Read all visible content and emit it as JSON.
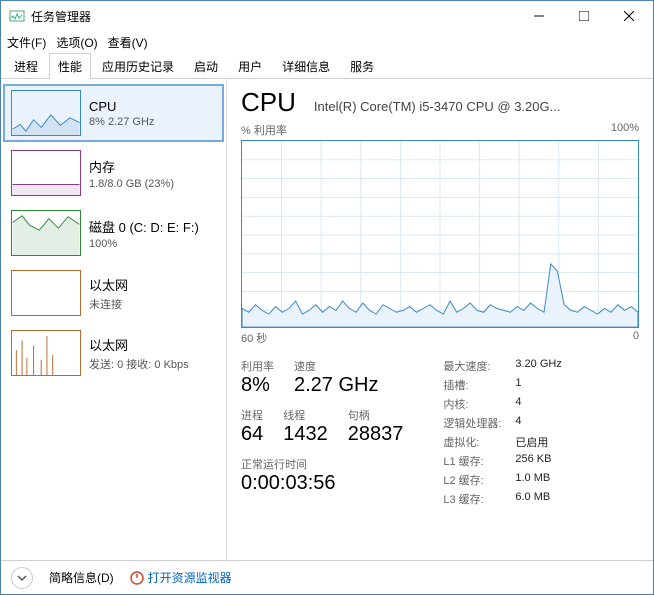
{
  "window": {
    "title": "任务管理器"
  },
  "menu": {
    "file": "文件(F)",
    "options": "选项(O)",
    "view": "查看(V)"
  },
  "tabs": [
    "进程",
    "性能",
    "应用历史记录",
    "启动",
    "用户",
    "详细信息",
    "服务"
  ],
  "active_tab": 1,
  "sidebar": [
    {
      "name": "CPU",
      "sub": "8%  2.27 GHz",
      "border": "#3a88c7",
      "type": "line"
    },
    {
      "name": "内存",
      "sub": "1.8/8.0 GB (23%)",
      "border": "#8b3a8b",
      "type": "flat"
    },
    {
      "name": "磁盘 0 (C: D: E: F:)",
      "sub": "100%",
      "border": "#2a8a3a",
      "type": "high"
    },
    {
      "name": "以太网",
      "sub": "未连接",
      "border": "#b86a2a",
      "type": "empty"
    },
    {
      "name": "以太网",
      "sub": "发送: 0 接收: 0 Kbps",
      "border": "#b86a2a",
      "type": "spikes"
    }
  ],
  "main": {
    "title": "CPU",
    "desc": "Intel(R) Core(TM) i5-3470 CPU @ 3.20G...",
    "y_label": "% 利用率",
    "y_max": "100%",
    "x_label_left": "60 秒",
    "x_label_right": "0"
  },
  "stats_left": {
    "row1": [
      {
        "label": "利用率",
        "val": "8%"
      },
      {
        "label": "速度",
        "val": "2.27 GHz"
      }
    ],
    "row2": [
      {
        "label": "进程",
        "val": "64"
      },
      {
        "label": "线程",
        "val": "1432"
      },
      {
        "label": "句柄",
        "val": "28837"
      }
    ],
    "uptime_label": "正常运行时间",
    "uptime_val": "0:00:03:56"
  },
  "stats_right": [
    {
      "k": "最大速度:",
      "v": "3.20 GHz"
    },
    {
      "k": "插槽:",
      "v": "1"
    },
    {
      "k": "内核:",
      "v": "4"
    },
    {
      "k": "逻辑处理器:",
      "v": "4"
    },
    {
      "k": "虚拟化:",
      "v": "已启用"
    },
    {
      "k": "L1 缓存:",
      "v": "256 KB"
    },
    {
      "k": "L2 缓存:",
      "v": "1.0 MB"
    },
    {
      "k": "L3 缓存:",
      "v": "6.0 MB"
    }
  ],
  "footer": {
    "less": "简略信息(D)",
    "monitor": "打开资源监视器"
  },
  "chart_data": {
    "type": "area",
    "title": "% 利用率",
    "xlabel": "秒",
    "ylabel": "利用率 %",
    "ylim": [
      0,
      100
    ],
    "x_range_seconds": [
      60,
      0
    ],
    "series": [
      {
        "name": "CPU 利用率",
        "values": [
          10,
          8,
          12,
          9,
          7,
          11,
          8,
          10,
          14,
          7,
          9,
          12,
          8,
          11,
          9,
          14,
          10,
          8,
          13,
          9,
          7,
          12,
          10,
          8,
          9,
          11,
          8,
          10,
          12,
          9,
          7,
          14,
          8,
          10,
          13,
          9,
          8,
          12,
          10,
          9,
          8,
          11,
          9,
          13,
          10,
          8,
          34,
          30,
          12,
          9,
          8,
          11,
          9,
          7,
          10,
          8,
          12,
          9,
          11,
          8
        ]
      }
    ]
  }
}
